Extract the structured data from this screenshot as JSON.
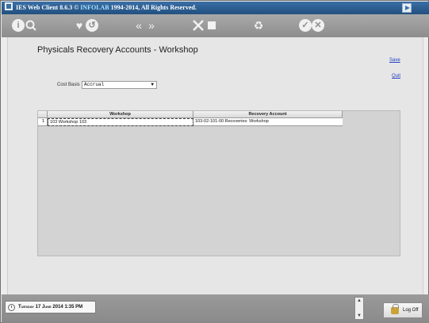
{
  "app": {
    "title_brand": "IES Web Client 8.6.3 ©",
    "title_company": "INFOLAB",
    "title_rest": "1994-2014, All Rights Reserved."
  },
  "toolbar": {
    "icons": [
      "info-icon",
      "search-icon",
      "favorite-icon",
      "history-icon",
      "previous-icon",
      "next-icon",
      "tools-icon",
      "stop-icon",
      "recycle-icon",
      "confirm-icon",
      "cancel-icon"
    ]
  },
  "page": {
    "title": "Physicals Recovery Accounts - Workshop",
    "save_label": "Save",
    "quit_label": "Quit"
  },
  "cost_basis": {
    "label": "Cost Basis",
    "value": "Accrual"
  },
  "grid": {
    "columns": [
      "Workshop",
      "Recovery Account"
    ],
    "rows": [
      {
        "indicator": "1",
        "workshop": "103 Workshop 103",
        "account": "103-02-101-00 Recoveries: Workshop"
      }
    ]
  },
  "status": {
    "datetime": "Tuesday 17 June 2014 1:35 PM",
    "logoff_label": "Log Off"
  },
  "colors": {
    "titlebar": "#21507f",
    "toolbar": "#8d8d8d",
    "link": "#1d3fbf"
  }
}
